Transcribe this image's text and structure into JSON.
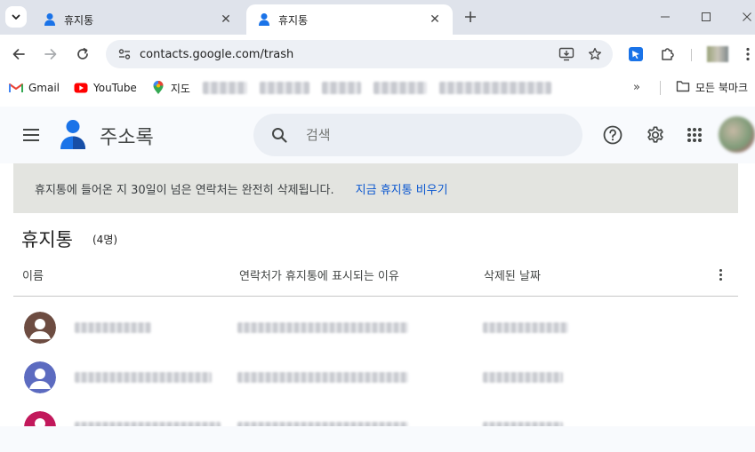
{
  "browser": {
    "tabs": [
      {
        "title": "휴지통",
        "active": false
      },
      {
        "title": "휴지통",
        "active": true
      }
    ],
    "url": "contacts.google.com/trash",
    "bookmarks": [
      {
        "label": "Gmail",
        "icon": "gmail-icon"
      },
      {
        "label": "YouTube",
        "icon": "youtube-icon"
      },
      {
        "label": "지도",
        "icon": "maps-icon"
      }
    ],
    "bookmarks_folder": "모든 북마크",
    "bookmarks_more": "»"
  },
  "app": {
    "name": "주소록",
    "search_placeholder": "검색"
  },
  "banner": {
    "message": "휴지통에 들어온 지 30일이 넘은 연락처는 완전히 삭제됩니다.",
    "action": "지금 휴지통 비우기"
  },
  "page": {
    "title": "휴지통",
    "count": "(4명)"
  },
  "table": {
    "columns": [
      "이름",
      "연락처가 휴지통에 표시되는 이유",
      "삭제된 날짜"
    ],
    "rows": [
      {
        "avatar_color": "#6d4c41"
      },
      {
        "avatar_color": "#5c6bc0"
      },
      {
        "avatar_color": "#c2185b"
      }
    ]
  },
  "colors": {
    "accent": "#0b57d0",
    "header_bg": "#f8fafd",
    "banner_bg": "#e3e4e0"
  }
}
